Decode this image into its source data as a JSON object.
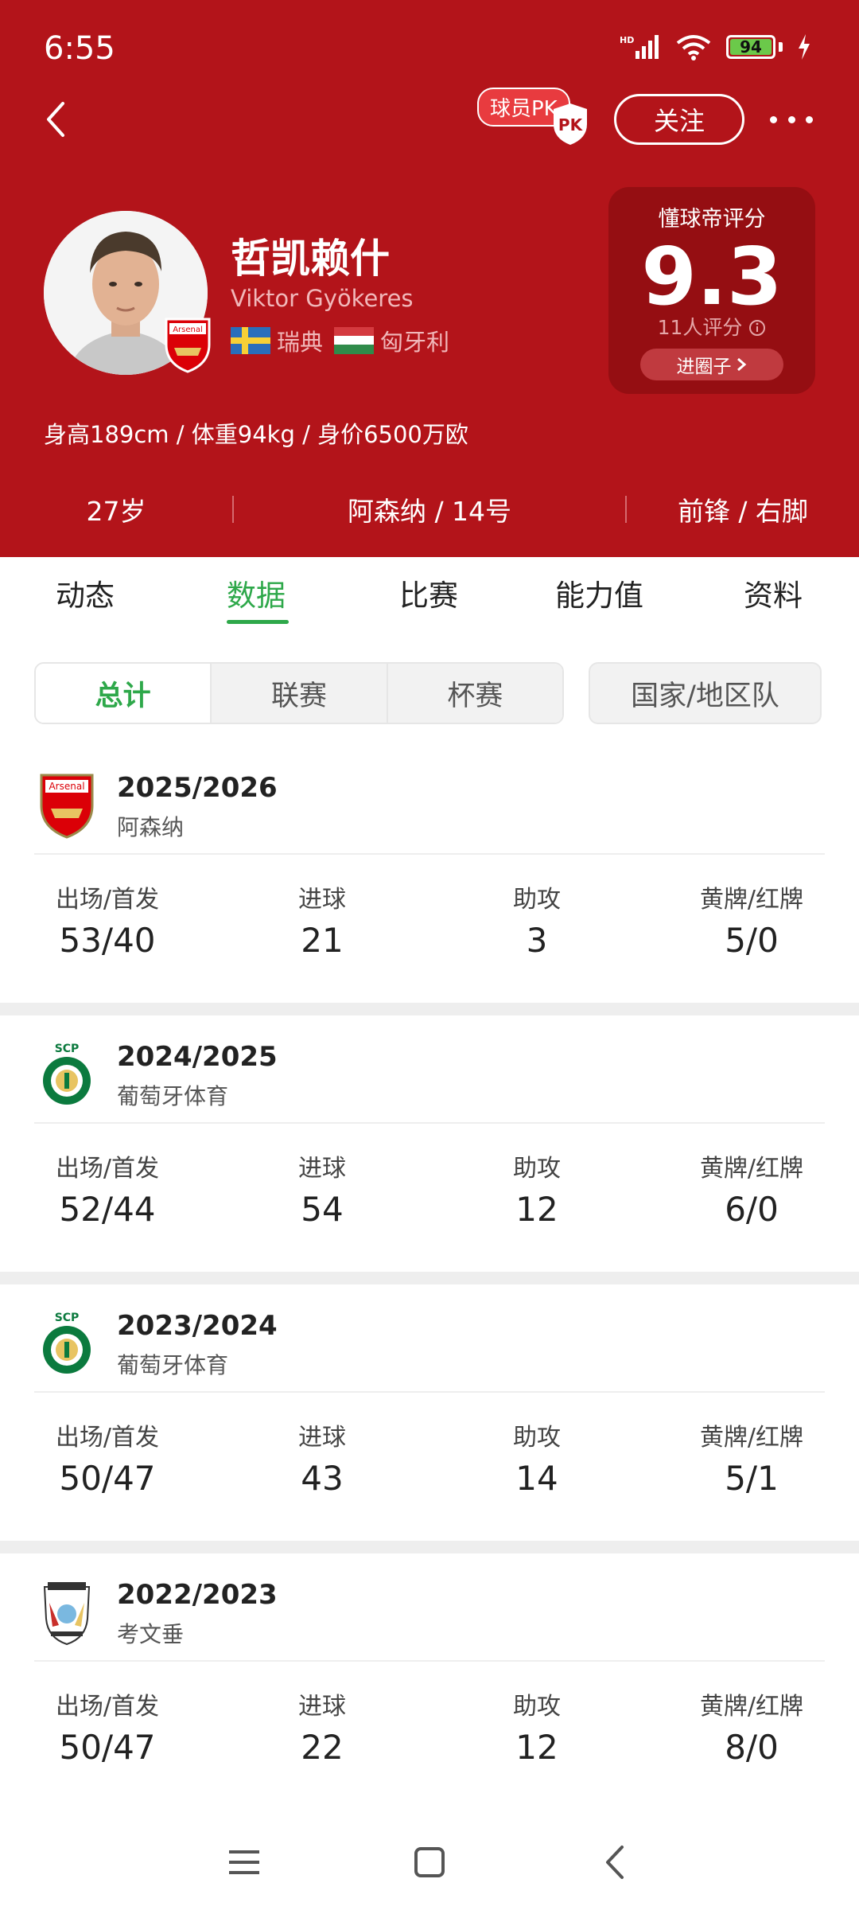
{
  "status_bar": {
    "time": "6:55",
    "battery": "94",
    "network": "HD"
  },
  "header": {
    "pk_label": "球员PK",
    "pk_shield": "PK",
    "follow_label": "关注"
  },
  "player": {
    "name_cn": "哲凯赖什",
    "name_en": "Viktor Gyökeres",
    "nation1": "瑞典",
    "nation2": "匈牙利",
    "club_badge_text": "Arsenal",
    "body_info": "身高189cm / 体重94kg / 身价6500万欧",
    "age": "27岁",
    "club_number": "阿森纳 / 14号",
    "position_foot": "前锋 / 右脚"
  },
  "rating": {
    "label": "懂球帝评分",
    "value": "9.3",
    "count": "11人评分",
    "button": "进圈子"
  },
  "tabs": [
    {
      "label": "动态"
    },
    {
      "label": "数据",
      "active": true
    },
    {
      "label": "比赛"
    },
    {
      "label": "能力值"
    },
    {
      "label": "资料"
    }
  ],
  "segments": {
    "total": "总计",
    "league": "联赛",
    "cup": "杯赛",
    "national": "国家/地区队"
  },
  "stat_labels": {
    "apps": "出场/首发",
    "goals": "进球",
    "assists": "助攻",
    "cards": "黄牌/红牌"
  },
  "seasons": [
    {
      "year": "2025/2026",
      "club": "阿森纳",
      "apps": "53/40",
      "goals": "21",
      "assists": "3",
      "cards": "5/0"
    },
    {
      "year": "2024/2025",
      "club": "葡萄牙体育",
      "apps": "52/44",
      "goals": "54",
      "assists": "12",
      "cards": "6/0"
    },
    {
      "year": "2023/2024",
      "club": "葡萄牙体育",
      "apps": "50/47",
      "goals": "43",
      "assists": "14",
      "cards": "5/1"
    },
    {
      "year": "2022/2023",
      "club": "考文垂",
      "apps": "50/47",
      "goals": "22",
      "assists": "12",
      "cards": "8/0"
    }
  ],
  "colors": {
    "header_red": "#b3141a",
    "rating_red": "#950e12",
    "accent_green": "#2ea84a"
  },
  "icons": [
    "back-arrow-icon",
    "more-dots-icon",
    "info-icon",
    "chevron-right-icon",
    "menu-icon",
    "home-icon",
    "system-back-icon"
  ]
}
